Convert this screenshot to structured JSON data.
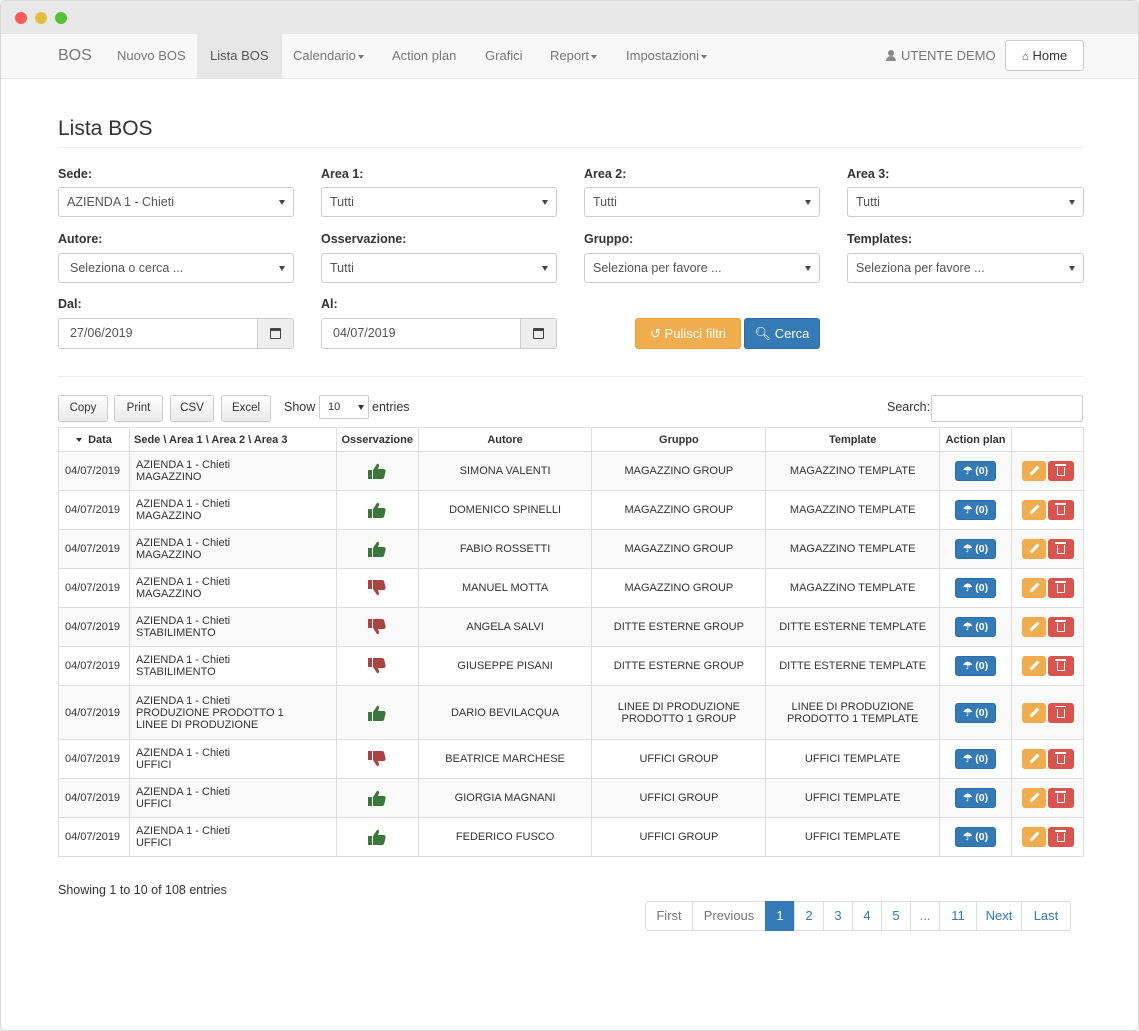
{
  "navbar": {
    "brand": "BOS",
    "items": [
      {
        "label": "Nuovo BOS"
      },
      {
        "label": "Lista BOS"
      },
      {
        "label": "Calendario"
      },
      {
        "label": "Action plan"
      },
      {
        "label": "Grafici"
      },
      {
        "label": "Report"
      },
      {
        "label": "Impostazioni"
      }
    ],
    "user": "UTENTE DEMO",
    "home": "Home"
  },
  "page": {
    "title": "Lista BOS"
  },
  "filters": {
    "sede": {
      "label": "Sede:",
      "value": "AZIENDA 1 - Chieti"
    },
    "area1": {
      "label": "Area 1:",
      "value": "Tutti"
    },
    "area2": {
      "label": "Area 2:",
      "value": "Tutti"
    },
    "area3": {
      "label": "Area 3:",
      "value": "Tutti"
    },
    "autore": {
      "label": "Autore:",
      "value": "Seleziona o cerca ..."
    },
    "osservazione": {
      "label": "Osservazione:",
      "value": "Tutti"
    },
    "gruppo": {
      "label": "Gruppo:",
      "value": "Seleziona per favore ..."
    },
    "templates": {
      "label": "Templates:",
      "value": "Seleziona per favore ..."
    },
    "dal": {
      "label": "Dal:",
      "value": "27/06/2019"
    },
    "al": {
      "label": "Al:",
      "value": "04/07/2019"
    },
    "clear_label": "Pulisci filtri",
    "search_label": "Cerca"
  },
  "toolbar": {
    "copy": "Copy",
    "print": "Print",
    "csv": "CSV",
    "excel": "Excel",
    "show": "Show",
    "entries_value": "10",
    "entries": "entries",
    "search": "Search:"
  },
  "table": {
    "headers": [
      "Data",
      "Sede \\ Area 1 \\ Area 2 \\ Area 3",
      "Osservazione",
      "Autore",
      "Gruppo",
      "Template",
      "Action plan",
      ""
    ],
    "rows": [
      {
        "date": "04/07/2019",
        "sede1": "AZIENDA 1 - Chieti",
        "sede2": "MAGAZZINO",
        "sede3": "",
        "obs": "positive",
        "autore": "SIMONA VALENTI",
        "gruppo1": "MAGAZZINO GROUP",
        "gruppo2": "",
        "tpl1": "MAGAZZINO TEMPLATE",
        "tpl2": "",
        "ap": "(0)"
      },
      {
        "date": "04/07/2019",
        "sede1": "AZIENDA 1 - Chieti",
        "sede2": "MAGAZZINO",
        "sede3": "",
        "obs": "positive",
        "autore": "DOMENICO SPINELLI",
        "gruppo1": "MAGAZZINO GROUP",
        "gruppo2": "",
        "tpl1": "MAGAZZINO TEMPLATE",
        "tpl2": "",
        "ap": "(0)"
      },
      {
        "date": "04/07/2019",
        "sede1": "AZIENDA 1 - Chieti",
        "sede2": "MAGAZZINO",
        "sede3": "",
        "obs": "positive",
        "autore": "FABIO ROSSETTI",
        "gruppo1": "MAGAZZINO GROUP",
        "gruppo2": "",
        "tpl1": "MAGAZZINO TEMPLATE",
        "tpl2": "",
        "ap": "(0)"
      },
      {
        "date": "04/07/2019",
        "sede1": "AZIENDA 1 - Chieti",
        "sede2": "MAGAZZINO",
        "sede3": "",
        "obs": "negative",
        "autore": "MANUEL MOTTA",
        "gruppo1": "MAGAZZINO GROUP",
        "gruppo2": "",
        "tpl1": "MAGAZZINO TEMPLATE",
        "tpl2": "",
        "ap": "(0)"
      },
      {
        "date": "04/07/2019",
        "sede1": "AZIENDA 1 - Chieti",
        "sede2": "STABILIMENTO",
        "sede3": "",
        "obs": "negative",
        "autore": "ANGELA SALVI",
        "gruppo1": "DITTE ESTERNE GROUP",
        "gruppo2": "",
        "tpl1": "DITTE ESTERNE TEMPLATE",
        "tpl2": "",
        "ap": "(0)"
      },
      {
        "date": "04/07/2019",
        "sede1": "AZIENDA 1 - Chieti",
        "sede2": "STABILIMENTO",
        "sede3": "",
        "obs": "negative",
        "autore": "GIUSEPPE PISANI",
        "gruppo1": "DITTE ESTERNE GROUP",
        "gruppo2": "",
        "tpl1": "DITTE ESTERNE TEMPLATE",
        "tpl2": "",
        "ap": "(0)"
      },
      {
        "date": "04/07/2019",
        "sede1": "AZIENDA 1 - Chieti",
        "sede2": "PRODUZIONE PRODOTTO 1",
        "sede3": "LINEE DI PRODUZIONE",
        "obs": "positive",
        "autore": "DARIO BEVILACQUA",
        "gruppo1": "LINEE DI PRODUZIONE",
        "gruppo2": "PRODOTTO 1 GROUP",
        "tpl1": "LINEE DI PRODUZIONE",
        "tpl2": "PRODOTTO 1 TEMPLATE",
        "ap": "(0)"
      },
      {
        "date": "04/07/2019",
        "sede1": "AZIENDA 1 - Chieti",
        "sede2": "UFFICI",
        "sede3": "",
        "obs": "negative",
        "autore": "BEATRICE MARCHESE",
        "gruppo1": "UFFICI GROUP",
        "gruppo2": "",
        "tpl1": "UFFICI TEMPLATE",
        "tpl2": "",
        "ap": "(0)"
      },
      {
        "date": "04/07/2019",
        "sede1": "AZIENDA 1 - Chieti",
        "sede2": "UFFICI",
        "sede3": "",
        "obs": "positive",
        "autore": "GIORGIA MAGNANI",
        "gruppo1": "UFFICI GROUP",
        "gruppo2": "",
        "tpl1": "UFFICI TEMPLATE",
        "tpl2": "",
        "ap": "(0)"
      },
      {
        "date": "04/07/2019",
        "sede1": "AZIENDA 1 - Chieti",
        "sede2": "UFFICI",
        "sede3": "",
        "obs": "positive",
        "autore": "FEDERICO FUSCO",
        "gruppo1": "UFFICI GROUP",
        "gruppo2": "",
        "tpl1": "UFFICI TEMPLATE",
        "tpl2": "",
        "ap": "(0)"
      }
    ]
  },
  "footer": {
    "info": "Showing 1 to 10 of 108 entries",
    "pages": [
      "First",
      "Previous",
      "1",
      "2",
      "3",
      "4",
      "5",
      "...",
      "11",
      "Next",
      "Last"
    ]
  },
  "colors": {
    "thumb_up": "#3c763d",
    "thumb_down": "#a94442",
    "primary": "#337ab7",
    "warning": "#f0ad4e",
    "danger": "#d9534f"
  }
}
